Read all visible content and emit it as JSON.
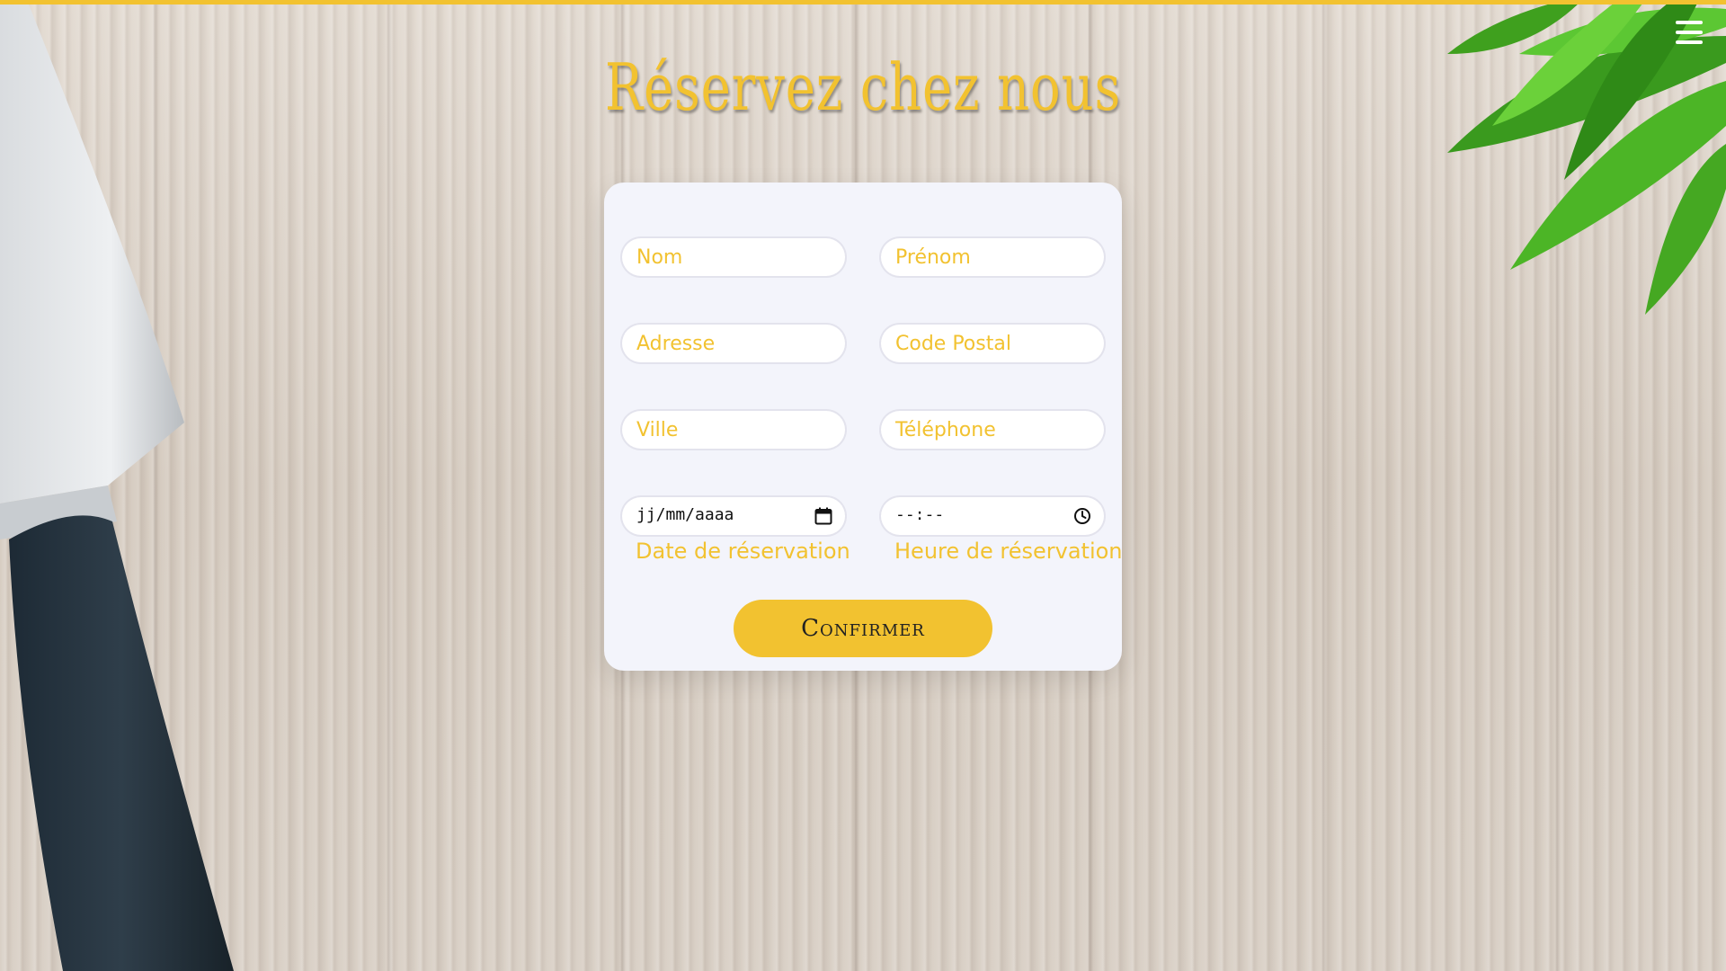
{
  "colors": {
    "accent": "#f2c230",
    "card_bg": "#f3f4fb",
    "button_text": "#222222"
  },
  "header": {
    "menu_icon": "hamburger-menu-icon",
    "title": "Réservez chez nous"
  },
  "form": {
    "fields": {
      "nom": {
        "placeholder": "Nom"
      },
      "prenom": {
        "placeholder": "Prénom"
      },
      "adresse": {
        "placeholder": "Adresse"
      },
      "code_postal": {
        "placeholder": "Code Postal"
      },
      "ville": {
        "placeholder": "Ville"
      },
      "telephone": {
        "placeholder": "Téléphone"
      }
    },
    "date": {
      "value": "jj/mm/aaaa",
      "label": "Date de réservation",
      "icon": "calendar-icon"
    },
    "time": {
      "value": "--:--",
      "label": "Heure de réservation",
      "icon": "clock-icon"
    },
    "confirm_label": "Confirmer"
  }
}
